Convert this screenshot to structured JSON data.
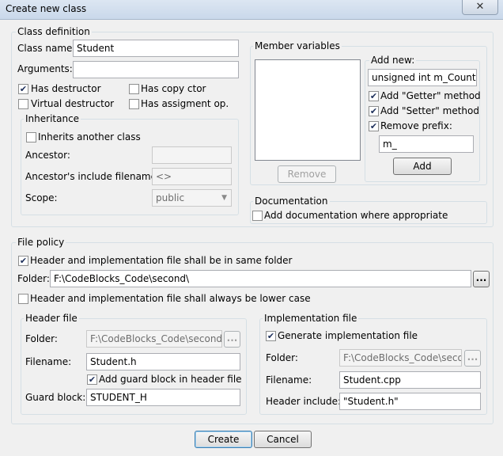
{
  "window": {
    "title": "Create new class",
    "close_glyph": "✕"
  },
  "class_definition": {
    "group_label": "Class definition",
    "class_name_label": "Class name:",
    "class_name_value": "Student",
    "arguments_label": "Arguments:",
    "arguments_value": "",
    "has_destructor_label": "Has destructor",
    "has_destructor_checked": true,
    "virtual_destructor_label": "Virtual destructor",
    "virtual_destructor_checked": false,
    "has_copy_ctor_label": "Has copy ctor",
    "has_copy_ctor_checked": false,
    "has_assignment_label": "Has assigment op.",
    "has_assignment_checked": false,
    "inheritance": {
      "group_label": "Inheritance",
      "inherits_label": "Inherits another class",
      "inherits_checked": false,
      "ancestor_label": "Ancestor:",
      "ancestor_value": "",
      "ancestor_include_label": "Ancestor's include filename:",
      "ancestor_include_value": "<>",
      "scope_label": "Scope:",
      "scope_value": "public"
    }
  },
  "member_variables": {
    "group_label": "Member variables",
    "remove_label": "Remove",
    "add_new": {
      "group_label": "Add new:",
      "type_value": "unsigned int m_Counter",
      "getter_label": "Add \"Getter\" method",
      "getter_checked": true,
      "setter_label": "Add \"Setter\" method",
      "setter_checked": true,
      "remove_prefix_label": "Remove prefix:",
      "remove_prefix_checked": true,
      "prefix_value": "m_",
      "add_label": "Add"
    }
  },
  "documentation": {
    "group_label": "Documentation",
    "add_doc_label": "Add documentation where appropriate",
    "add_doc_checked": false
  },
  "file_policy": {
    "group_label": "File policy",
    "same_folder_label": "Header and implementation file shall be in same folder",
    "same_folder_checked": true,
    "folder_label": "Folder:",
    "folder_value": "F:\\CodeBlocks_Code\\second\\",
    "browse_label": "...",
    "lower_case_label": "Header and implementation file shall always be lower case",
    "lower_case_checked": false,
    "header": {
      "group_label": "Header file",
      "folder_label": "Folder:",
      "folder_value": "F:\\CodeBlocks_Code\\second\\in",
      "browse_label": "...",
      "filename_label": "Filename:",
      "filename_value": "Student.h",
      "guard_label": "Add guard block in header file",
      "guard_checked": true,
      "guard_block_label": "Guard block:",
      "guard_block_value": "STUDENT_H"
    },
    "implementation": {
      "group_label": "Implementation file",
      "generate_label": "Generate implementation file",
      "generate_checked": true,
      "folder_label": "Folder:",
      "folder_value": "F:\\CodeBlocks_Code\\secon",
      "browse_label": "...",
      "filename_label": "Filename:",
      "filename_value": "Student.cpp",
      "header_include_label": "Header include:",
      "header_include_value": "\"Student.h\""
    }
  },
  "buttons": {
    "create_label": "Create",
    "cancel_label": "Cancel"
  },
  "check_glyph": "✔"
}
